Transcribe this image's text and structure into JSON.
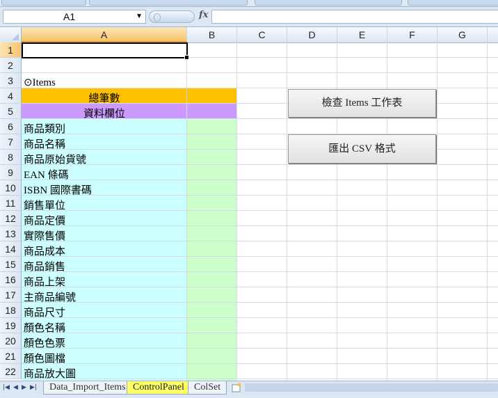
{
  "name_box": {
    "value": "A1"
  },
  "formula_bar": {
    "fx_label": "fx",
    "content": ""
  },
  "columns": [
    "A",
    "B",
    "C",
    "D",
    "E",
    "F",
    "G"
  ],
  "rows": [
    "1",
    "2",
    "3",
    "4",
    "5",
    "6",
    "7",
    "8",
    "9",
    "10",
    "11",
    "12",
    "13",
    "14",
    "15",
    "16",
    "17",
    "18",
    "19",
    "20",
    "21",
    "22"
  ],
  "cells": {
    "a3": "⊙Items",
    "a4": "總筆數",
    "a5": "資料欄位",
    "field_list": [
      "商品類別",
      "商品名稱",
      "商品原始貨號",
      "EAN 條碼",
      "ISBN 國際書碼",
      "銷售單位",
      "商品定價",
      "實際售價",
      "商品成本",
      "商品銷售",
      "商品上架",
      "主商品編號",
      "商品尺寸",
      "顏色名稱",
      "顏色色票",
      "顏色圖檔",
      "商品放大圖"
    ]
  },
  "buttons": {
    "check_items": "檢查 Items 工作表",
    "export_csv": "匯出 CSV 格式"
  },
  "sheet_tabs": [
    "Data_Import_Items",
    "ControlPanel",
    "ColSet"
  ],
  "active_tab": "ControlPanel",
  "colors": {
    "orange_fill": "#ffc000",
    "purple_fill": "#cc99ff",
    "cyan_fill": "#ccffff",
    "green_fill": "#ccffcc",
    "active_tab": "#ffff66"
  }
}
